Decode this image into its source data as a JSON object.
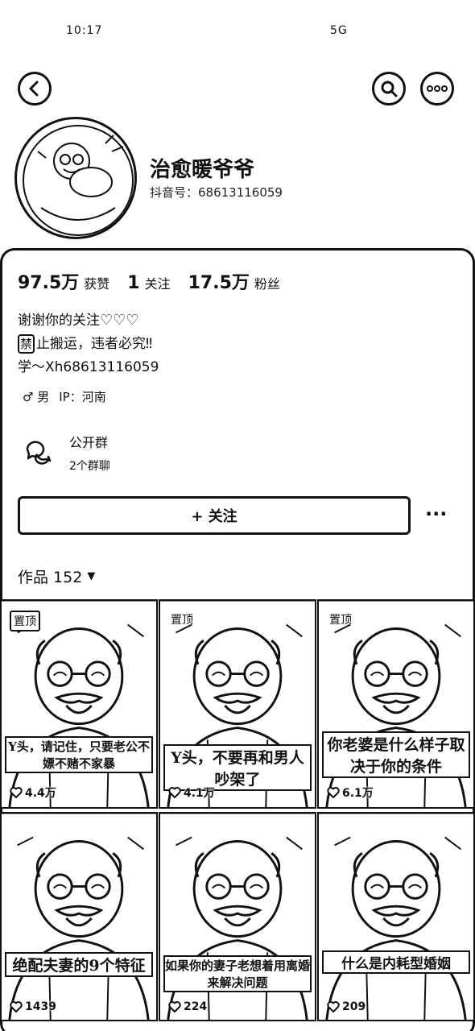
{
  "status_bar": {
    "left_text": "10:17",
    "right_text": "5G"
  },
  "header": {
    "back_icon": "chevron-left-icon",
    "search_icon": "search-icon",
    "more_icon": "more-dots-icon"
  },
  "profile": {
    "name": "治愈暖爷爷",
    "account_label": "抖音号：68613116059"
  },
  "stats": [
    {
      "value": "97.5万",
      "label": "获赞"
    },
    {
      "value": "1",
      "label": "关注"
    },
    {
      "value": "17.5万",
      "label": "粉丝"
    }
  ],
  "bio": {
    "line1": "谢谢你的关注",
    "line1_hearts": "♡♡♡",
    "line2_badge": "禁",
    "line2": "止搬运，违者必究",
    "line2_mark": "‼",
    "line3": "学～Xh68613116059"
  },
  "meta": {
    "gender": "♂ 男",
    "ip": "IP：河南"
  },
  "group": {
    "title": "公开群",
    "subtitle": "2个群聊"
  },
  "actions": {
    "follow_label": "+ 关注",
    "more_label": "···"
  },
  "works": {
    "label": "作品 152",
    "dropdown_icon": "triangle-down-icon"
  },
  "videos": [
    {
      "pin": "置顶",
      "caption": "Y头，请记住，只要老公不嫖不赌不家暴",
      "likes": "4.4万"
    },
    {
      "pin": "置顶",
      "caption": "Y头，不要再和男人吵架了",
      "likes": "4.1万"
    },
    {
      "pin": "置顶",
      "caption": "你老婆是什么样子取决于你的条件",
      "likes": "6.1万"
    },
    {
      "pin": "",
      "caption": "绝配夫妻的9个特征",
      "likes": "1439"
    },
    {
      "pin": "",
      "caption": "如果你的妻子老想着用离婚来解决问题",
      "likes": "224"
    },
    {
      "pin": "",
      "caption": "什么是内耗型婚姻",
      "likes": "209"
    }
  ]
}
